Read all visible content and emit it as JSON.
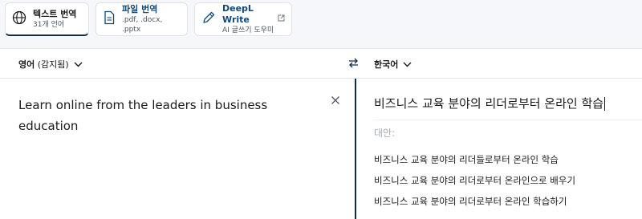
{
  "tabs": [
    {
      "title": "텍스트 번역",
      "subtitle": "31개 언어",
      "icon": "globe-icon"
    },
    {
      "title": "파일 번역",
      "subtitle": ".pdf, .docx, .pptx",
      "icon": "document-icon"
    },
    {
      "title": "DeepL Write",
      "subtitle": "AI 글쓰기 도우미",
      "icon": "pen-icon"
    }
  ],
  "source": {
    "language": "영어",
    "detected_label": "(감지됨)",
    "text": "Learn online from the leaders in business education"
  },
  "target": {
    "language": "한국어",
    "text": "비즈니스 교육 분야의 리더로부터 온라인 학습",
    "alternatives_label": "대안:",
    "alternatives": [
      "비즈니스 교육 분야의 리더들로부터 온라인 학습",
      "비즈니스 교육 분야의 리더로부터 온라인으로 배우기",
      "비즈니스 교육 분야의 리더로부터 온라인 학습하기"
    ]
  },
  "colors": {
    "accent": "#0f2b46",
    "link_blue": "#0f4a7a",
    "page_bg": "#f5f7fa"
  }
}
